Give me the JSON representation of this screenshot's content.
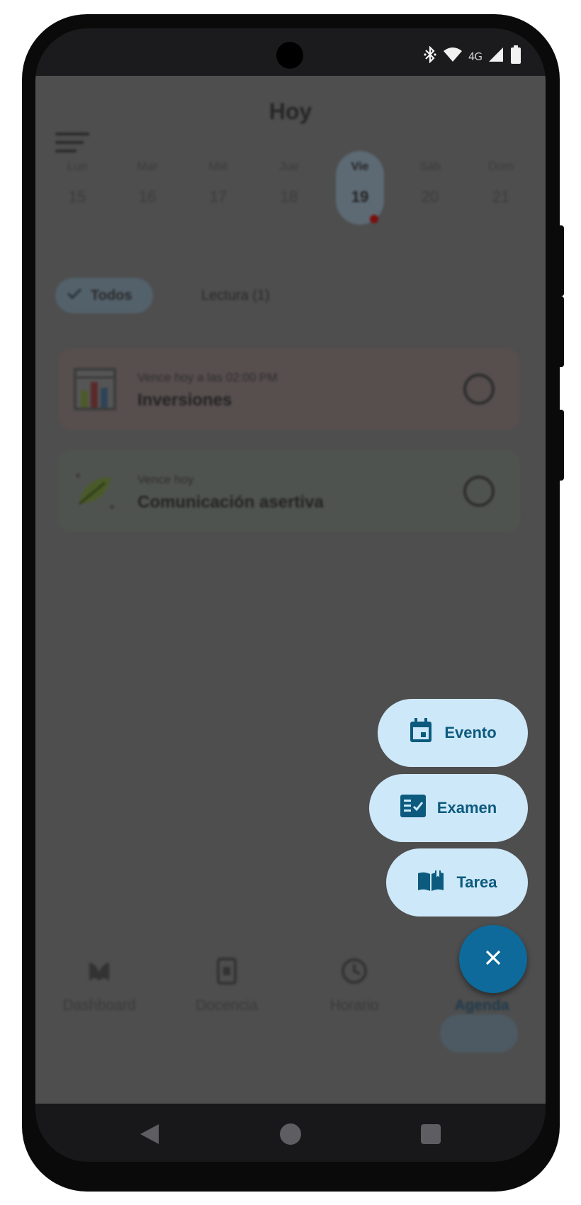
{
  "status_bar": {
    "network": "4G"
  },
  "header": {
    "title": "Hoy"
  },
  "week": {
    "days": [
      {
        "name": "Lun",
        "date": "15"
      },
      {
        "name": "Mar",
        "date": "16"
      },
      {
        "name": "Mié",
        "date": "17"
      },
      {
        "name": "Jue",
        "date": "18"
      },
      {
        "name": "Vie",
        "date": "19",
        "selected": true
      },
      {
        "name": "Sáb",
        "date": "20"
      },
      {
        "name": "Dom",
        "date": "21"
      }
    ]
  },
  "filters": {
    "all_label": "Todos",
    "reading_label": "Lectura (1)"
  },
  "tasks": [
    {
      "due": "Vence hoy a las 02:00 PM",
      "title": "Inversiones",
      "icon": "bar-chart-icon"
    },
    {
      "due": "Vence hoy",
      "title": "Comunicación asertiva",
      "icon": "leaf-icon"
    }
  ],
  "speed_dial": {
    "event_label": "Evento",
    "exam_label": "Examen",
    "task_label": "Tarea"
  },
  "bottom_nav": {
    "items": [
      {
        "label": "Dashboard",
        "icon": "dashboard-icon"
      },
      {
        "label": "Docencia",
        "icon": "docencia-icon"
      },
      {
        "label": "Horario",
        "icon": "clock-icon"
      },
      {
        "label": "Agenda",
        "icon": "agenda-icon",
        "active": true
      }
    ]
  },
  "colors": {
    "fab": "#0d6a9a",
    "pill": "#cde8f8",
    "pill_text": "#0c5a7e",
    "scrim": "#4e4e4e"
  }
}
